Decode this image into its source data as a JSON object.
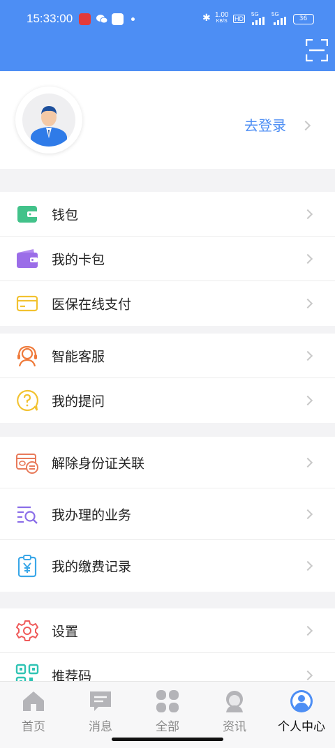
{
  "status_bar": {
    "time": "15:33:00",
    "net_speed_top": "1.00",
    "net_speed_unit": "KB/S",
    "hd": "HD",
    "signal1": "5G",
    "signal2": "5G",
    "battery": "36"
  },
  "profile": {
    "login_label": "去登录"
  },
  "groups": [
    {
      "items": [
        {
          "label": "钱包",
          "icon": "wallet-icon"
        },
        {
          "label": "我的卡包",
          "icon": "card-wallet-icon"
        },
        {
          "label": "医保在线支付",
          "icon": "card-pay-icon"
        }
      ]
    },
    {
      "items": [
        {
          "label": "智能客服",
          "icon": "customer-service-icon"
        },
        {
          "label": "我的提问",
          "icon": "question-icon"
        }
      ]
    },
    {
      "items": [
        {
          "label": "解除身份证关联",
          "icon": "id-card-unlink-icon"
        },
        {
          "label": "我办理的业务",
          "icon": "search-list-icon"
        },
        {
          "label": "我的缴费记录",
          "icon": "payment-record-icon"
        }
      ]
    },
    {
      "items": [
        {
          "label": "设置",
          "icon": "gear-icon"
        },
        {
          "label": "推荐码",
          "icon": "qr-code-icon"
        }
      ]
    }
  ],
  "tabs": [
    {
      "label": "首页",
      "icon": "home-icon"
    },
    {
      "label": "消息",
      "icon": "message-icon"
    },
    {
      "label": "全部",
      "icon": "grid-icon"
    },
    {
      "label": "资讯",
      "icon": "news-icon"
    },
    {
      "label": "个人中心",
      "icon": "profile-icon"
    }
  ],
  "colors": {
    "header": "#4d8ef4",
    "accent": "#4d8ef4"
  }
}
